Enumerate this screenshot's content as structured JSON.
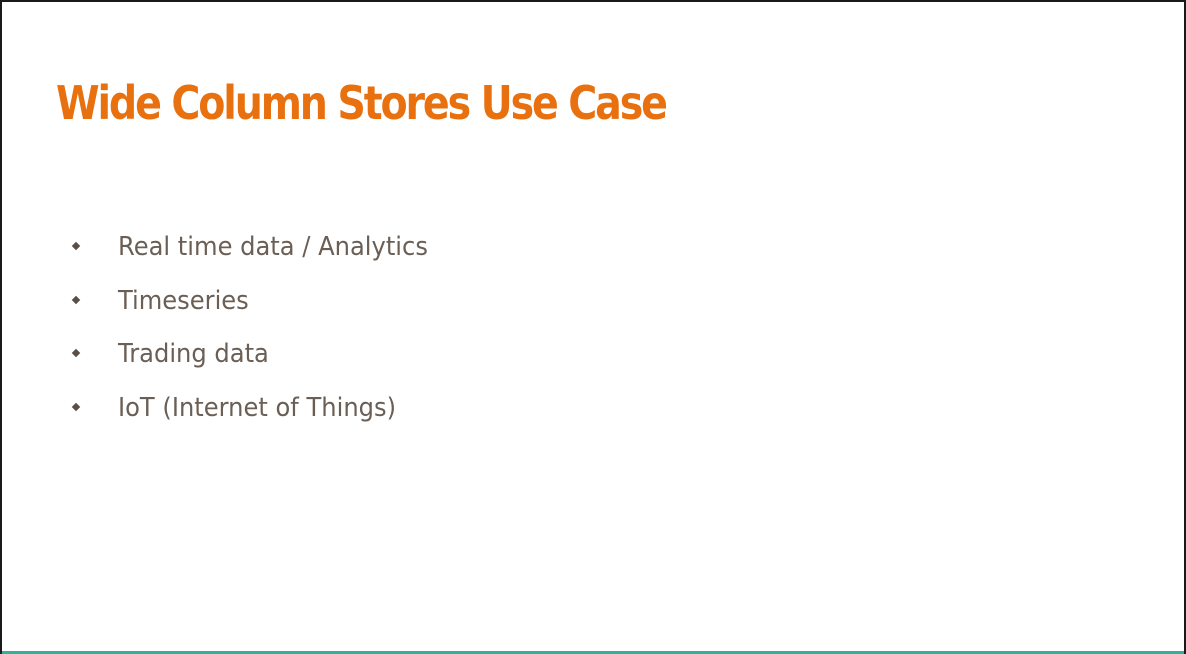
{
  "slide": {
    "title": "Wide Column Stores Use Case",
    "bullets": [
      "Real time data / Analytics",
      "Timeseries",
      "Trading data",
      "IoT (Internet of Things)"
    ]
  },
  "colors": {
    "title": "#e8700e",
    "body_text": "#6b5f55",
    "bullet": "#5a4e45",
    "bottom_strip": "#2bb59a"
  }
}
